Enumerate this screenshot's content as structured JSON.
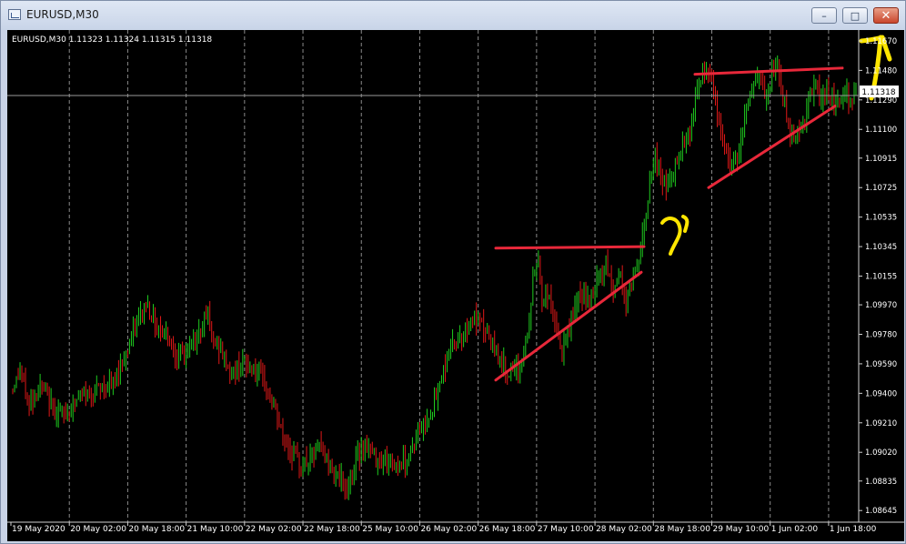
{
  "window": {
    "title": "EURUSD,M30"
  },
  "window_controls": {
    "minimize": "–",
    "maximize": "□",
    "close": "✕"
  },
  "chart_info": "EURUSD,M30  1.11323 1.11324 1.11315 1.11318",
  "chart_data": {
    "type": "candlestick",
    "symbol": "EURUSD",
    "timeframe": "M30",
    "ohlc": {
      "open": 1.11323,
      "high": 1.11324,
      "low": 1.11315,
      "close": 1.11318
    },
    "y_ticks": [
      "1.11670",
      "1.11480",
      "1.11290",
      "1.11100",
      "1.10915",
      "1.10725",
      "1.10535",
      "1.10345",
      "1.10155",
      "1.09970",
      "1.09780",
      "1.09590",
      "1.09400",
      "1.09210",
      "1.09020",
      "1.08835",
      "1.08645"
    ],
    "y_tick_values": [
      1.1167,
      1.1148,
      1.1129,
      1.111,
      1.10915,
      1.10725,
      1.10535,
      1.10345,
      1.10155,
      1.0997,
      1.0978,
      1.0959,
      1.094,
      1.0921,
      1.0902,
      1.08835,
      1.08645
    ],
    "ylim": [
      1.0857,
      1.1174
    ],
    "current_price": "1.11318",
    "x_ticks": [
      "19 May 2020",
      "20 May 02:00",
      "20 May 18:00",
      "21 May 10:00",
      "22 May 02:00",
      "22 May 18:00",
      "25 May 10:00",
      "26 May 02:00",
      "26 May 18:00",
      "27 May 10:00",
      "28 May 02:00",
      "28 May 18:00",
      "29 May 10:00",
      "1 Jun 02:00",
      "1 Jun 18:00"
    ],
    "x_tick_index": [
      0,
      32,
      64,
      96,
      128,
      160,
      192,
      224,
      256,
      288,
      320,
      352,
      384,
      416,
      448
    ],
    "n_bars": 463,
    "price_path": [
      [
        0,
        1.0943
      ],
      [
        4,
        1.0955
      ],
      [
        9,
        1.0932
      ],
      [
        15,
        1.0945
      ],
      [
        22,
        1.093
      ],
      [
        28,
        1.0926
      ],
      [
        36,
        1.0937
      ],
      [
        45,
        1.0942
      ],
      [
        55,
        1.0946
      ],
      [
        62,
        1.0966
      ],
      [
        68,
        1.0985
      ],
      [
        73,
        1.0998
      ],
      [
        78,
        1.0985
      ],
      [
        85,
        1.0978
      ],
      [
        90,
        1.0963
      ],
      [
        96,
        1.0966
      ],
      [
        103,
        1.0982
      ],
      [
        106,
        1.0996
      ],
      [
        109,
        1.0975
      ],
      [
        114,
        1.0968
      ],
      [
        120,
        1.0952
      ],
      [
        125,
        1.096
      ],
      [
        132,
        1.0955
      ],
      [
        138,
        1.0945
      ],
      [
        143,
        1.0932
      ],
      [
        148,
        1.0912
      ],
      [
        153,
        1.0901
      ],
      [
        158,
        1.0893
      ],
      [
        163,
        1.0898
      ],
      [
        168,
        1.0907
      ],
      [
        173,
        1.0895
      ],
      [
        178,
        1.0888
      ],
      [
        183,
        1.0876
      ],
      [
        187,
        1.0893
      ],
      [
        192,
        1.0908
      ],
      [
        197,
        1.0901
      ],
      [
        202,
        1.0897
      ],
      [
        210,
        1.0895
      ],
      [
        216,
        1.0897
      ],
      [
        220,
        1.0909
      ],
      [
        226,
        1.0922
      ],
      [
        232,
        1.0937
      ],
      [
        236,
        1.0955
      ],
      [
        240,
        1.097
      ],
      [
        246,
        1.0978
      ],
      [
        252,
        1.0988
      ],
      [
        258,
        1.0982
      ],
      [
        262,
        1.0973
      ],
      [
        266,
        1.0964
      ],
      [
        270,
        1.0955
      ],
      [
        275,
        1.0952
      ],
      [
        278,
        1.0958
      ],
      [
        282,
        1.0975
      ],
      [
        285,
        1.1012
      ],
      [
        288,
        1.1028
      ],
      [
        290,
        1.0998
      ],
      [
        293,
        1.1005
      ],
      [
        297,
        1.0985
      ],
      [
        301,
        1.0965
      ],
      [
        306,
        1.0988
      ],
      [
        311,
        1.1003
      ],
      [
        316,
        1.0998
      ],
      [
        321,
        1.1016
      ],
      [
        325,
        1.1022
      ],
      [
        329,
        1.1006
      ],
      [
        333,
        1.1018
      ],
      [
        336,
        1.0996
      ],
      [
        339,
        1.1012
      ],
      [
        343,
        1.1028
      ],
      [
        346,
        1.1047
      ],
      [
        349,
        1.1077
      ],
      [
        352,
        1.1093
      ],
      [
        355,
        1.1078
      ],
      [
        359,
        1.1074
      ],
      [
        363,
        1.1087
      ],
      [
        367,
        1.1102
      ],
      [
        371,
        1.111
      ],
      [
        375,
        1.1135
      ],
      [
        379,
        1.1147
      ],
      [
        382,
        1.1146
      ],
      [
        385,
        1.1125
      ],
      [
        389,
        1.1104
      ],
      [
        393,
        1.1086
      ],
      [
        397,
        1.1093
      ],
      [
        401,
        1.1118
      ],
      [
        405,
        1.1136
      ],
      [
        409,
        1.1142
      ],
      [
        413,
        1.1128
      ],
      [
        416,
        1.1145
      ],
      [
        419,
        1.1152
      ],
      [
        422,
        1.113
      ],
      [
        425,
        1.1112
      ],
      [
        428,
        1.1105
      ],
      [
        432,
        1.1112
      ],
      [
        436,
        1.1126
      ],
      [
        439,
        1.1138
      ],
      [
        443,
        1.1129
      ],
      [
        446,
        1.1136
      ],
      [
        450,
        1.1128
      ],
      [
        454,
        1.1134
      ],
      [
        458,
        1.113
      ],
      [
        462,
        1.11318
      ]
    ]
  },
  "annotations": {
    "lines_color": "#e8283a",
    "arrows_color": "#ffe600",
    "red_lines": [
      {
        "x1": 537,
        "y1": 1.10335,
        "x2": 700,
        "y2": 1.10345
      },
      {
        "x1": 537,
        "y1": 1.09485,
        "x2": 697,
        "y2": 1.1018
      },
      {
        "x1": 756,
        "y1": 1.11455,
        "x2": 918,
        "y2": 1.11495
      },
      {
        "x1": 771,
        "y1": 1.10725,
        "x2": 910,
        "y2": 1.1125
      }
    ]
  },
  "colors": {
    "bull": "#1fcc1f",
    "bear": "#e01818",
    "grid": "#8a8a8a",
    "axis": "#cfcfcf",
    "background": "#000000"
  }
}
